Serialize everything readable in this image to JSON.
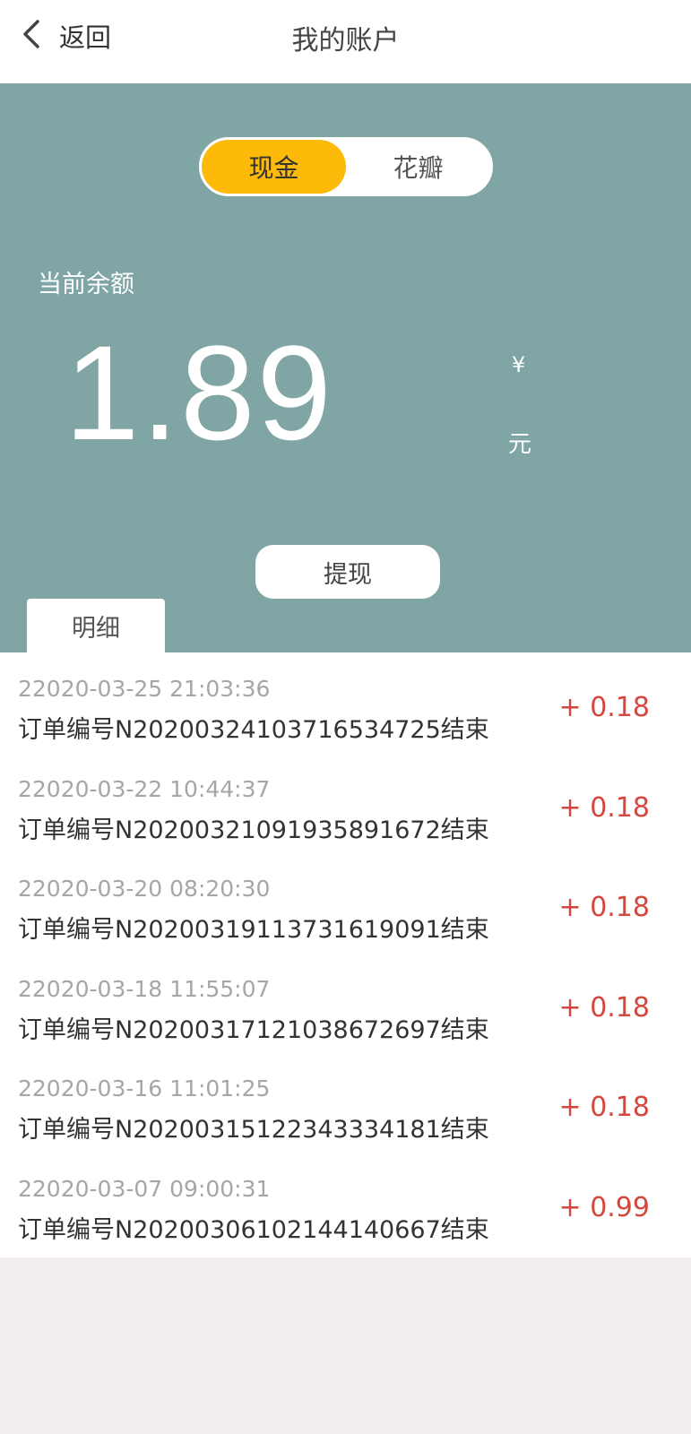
{
  "header": {
    "back_label": "返回",
    "title": "我的账户"
  },
  "toggle": {
    "options": [
      "现金",
      "花瓣"
    ],
    "selected": "现金"
  },
  "balance": {
    "label": "当前余额",
    "value": "1.89",
    "currency_symbol": "¥",
    "unit": "元"
  },
  "actions": {
    "withdraw_label": "提现"
  },
  "tabs": {
    "detail_label": "明细"
  },
  "transactions": [
    {
      "date": "22020-03-25 21:03:36",
      "desc": "订单编号N202003241037165347​25结束",
      "amount": "+ 0.18"
    },
    {
      "date": "22020-03-22 10:44:37",
      "desc": "订单编号N20200321091935891672结束",
      "amount": "+ 0.18"
    },
    {
      "date": "22020-03-20 08:20:30",
      "desc": "订单编号N20200319113731619091结束",
      "amount": "+ 0.18"
    },
    {
      "date": "22020-03-18 11:55:07",
      "desc": "订单编号N20200317121038672697结束",
      "amount": "+ 0.18"
    },
    {
      "date": "22020-03-16 11:01:25",
      "desc": "订单编号N20200315122343334181结束",
      "amount": "+ 0.18"
    },
    {
      "date": "22020-03-07 09:00:31",
      "desc": "订单编号N20200306102144140667结束",
      "amount": "+ 0.99"
    }
  ],
  "colors": {
    "hero_bg": "#7fa5a4",
    "toggle_active": "#fdba08",
    "amount": "#d5463c",
    "page_bg": "#f1edee"
  },
  "icons": {
    "back": "chevron-left-icon"
  }
}
